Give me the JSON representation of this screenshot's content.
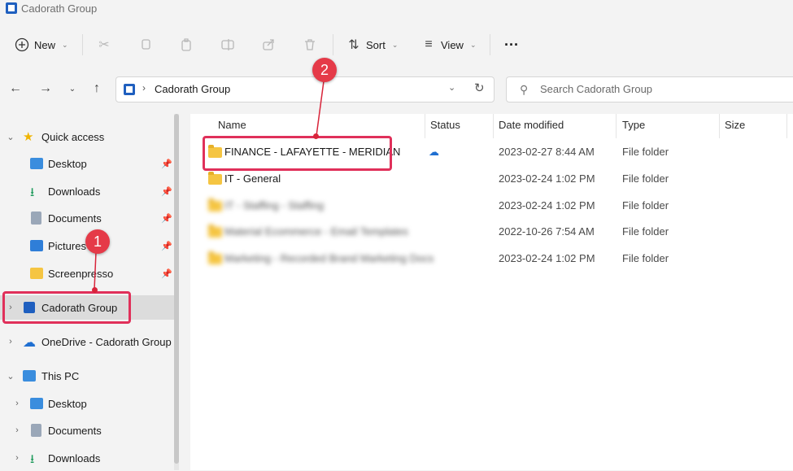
{
  "window": {
    "title": "Cadorath Group"
  },
  "toolbar": {
    "new_label": "New",
    "sort_label": "Sort",
    "view_label": "View",
    "more_label": "···"
  },
  "address": {
    "path": "Cadorath Group"
  },
  "search": {
    "placeholder": "Search Cadorath Group"
  },
  "sidebar": {
    "quick_access": "Quick access",
    "quick_items": [
      "Desktop",
      "Downloads",
      "Documents",
      "Pictures",
      "Screenpresso"
    ],
    "cadorath": "Cadorath Group",
    "onedrive": "OneDrive - Cadorath Group",
    "this_pc": "This PC",
    "pc_items": [
      "Desktop",
      "Documents",
      "Downloads"
    ]
  },
  "columns": {
    "name": "Name",
    "status": "Status",
    "date": "Date modified",
    "type": "Type",
    "size": "Size"
  },
  "files": [
    {
      "name": "FINANCE - LAFAYETTE - MERIDIAN",
      "date": "2023-02-27 8:44 AM",
      "type": "File folder",
      "status": "cloud"
    },
    {
      "name": "IT - General",
      "date": "2023-02-24 1:02 PM",
      "type": "File folder",
      "status": ""
    },
    {
      "name": "IT - Staffing - Staffing",
      "date": "2023-02-24 1:02 PM",
      "type": "File folder",
      "status": ""
    },
    {
      "name": "Material Ecommerce - Email Templates",
      "date": "2022-10-26 7:54 AM",
      "type": "File folder",
      "status": ""
    },
    {
      "name": "Marketing - Recorded Brand Marketing Docs",
      "date": "2023-02-24 1:02 PM",
      "type": "File folder",
      "status": ""
    }
  ],
  "callouts": {
    "one": "1",
    "two": "2"
  },
  "colors": {
    "accent": "#e0305a",
    "folder": "#f5c542",
    "cloud": "#1f6fd1"
  }
}
